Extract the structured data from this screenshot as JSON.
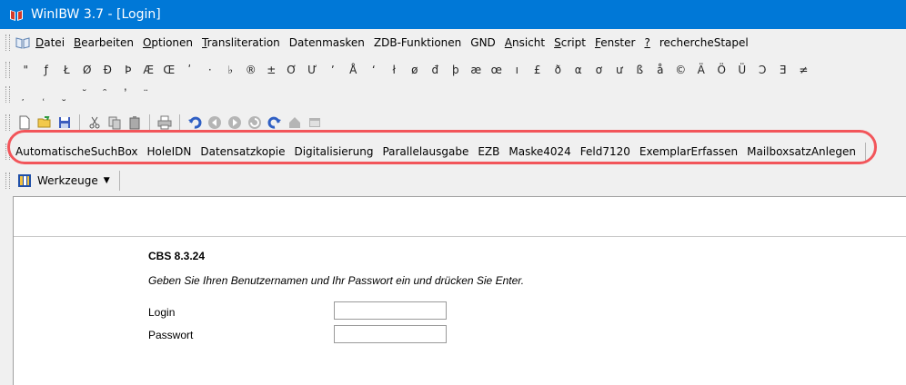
{
  "window": {
    "title": "WinIBW 3.7 - [Login]"
  },
  "menu": [
    {
      "pre": "",
      "u": "D",
      "post": "atei"
    },
    {
      "pre": "",
      "u": "B",
      "post": "earbeiten"
    },
    {
      "pre": "",
      "u": "O",
      "post": "ptionen"
    },
    {
      "pre": "",
      "u": "T",
      "post": "ransliteration"
    },
    {
      "pre": "Datenmasken",
      "u": "",
      "post": ""
    },
    {
      "pre": "ZDB-Funktionen",
      "u": "",
      "post": ""
    },
    {
      "pre": "GND",
      "u": "",
      "post": ""
    },
    {
      "pre": "",
      "u": "A",
      "post": "nsicht"
    },
    {
      "pre": "",
      "u": "S",
      "post": "cript"
    },
    {
      "pre": "",
      "u": "F",
      "post": "enster"
    },
    {
      "pre": "",
      "u": "?",
      "post": ""
    },
    {
      "pre": "rechercheStapel",
      "u": "",
      "post": ""
    }
  ],
  "chars_row1": [
    "\"",
    "ƒ",
    "Ł",
    "Ø",
    "Đ",
    "Þ",
    "Æ",
    "Œ",
    "ʹ",
    "·",
    "♭",
    "®",
    "±",
    "Ơ",
    "Ư",
    "ʼ",
    "Å",
    "ʻ",
    "ł",
    "ø",
    "đ",
    "þ",
    "æ",
    "œ",
    "ı",
    "£",
    "ð",
    "α",
    "ơ",
    "ư",
    "ß",
    "å",
    "©",
    "Ä",
    "Ö",
    "Ü",
    "Ɔ",
    "Ǝ",
    "≠"
  ],
  "chars_row2": [
    "̦",
    "̜",
    "̮",
    "̆",
    "̑",
    "̓",
    "̈"
  ],
  "toolbar_icons": [
    "new-document-icon",
    "open-folder-icon",
    "save-icon",
    "sep",
    "cut-icon",
    "copy-icon",
    "paste-icon",
    "sep",
    "print-icon",
    "sep",
    "undo-icon",
    "back-icon",
    "forward-icon",
    "refresh-icon",
    "redo-icon",
    "home-icon",
    "window-icon"
  ],
  "macros": [
    "AutomatischeSuchBox",
    "HoleIDN",
    "Datensatzkopie",
    "Digitalisierung",
    "Parallelausgabe",
    "EZB",
    "Maske4024",
    "Feld7120",
    "ExemplarErfassen",
    "MailboxsatzAnlegen"
  ],
  "werkzeuge": {
    "label": "Werkzeuge"
  },
  "login": {
    "version": "CBS 8.3.24",
    "instruction": "Geben Sie Ihren Benutzernamen und Ihr Passwort ein und drücken Sie Enter.",
    "login_label": "Login",
    "password_label": "Passwort",
    "login_value": "",
    "password_value": ""
  },
  "colors": {
    "titlebar": "#0078d7",
    "highlight": "#f2555a"
  }
}
